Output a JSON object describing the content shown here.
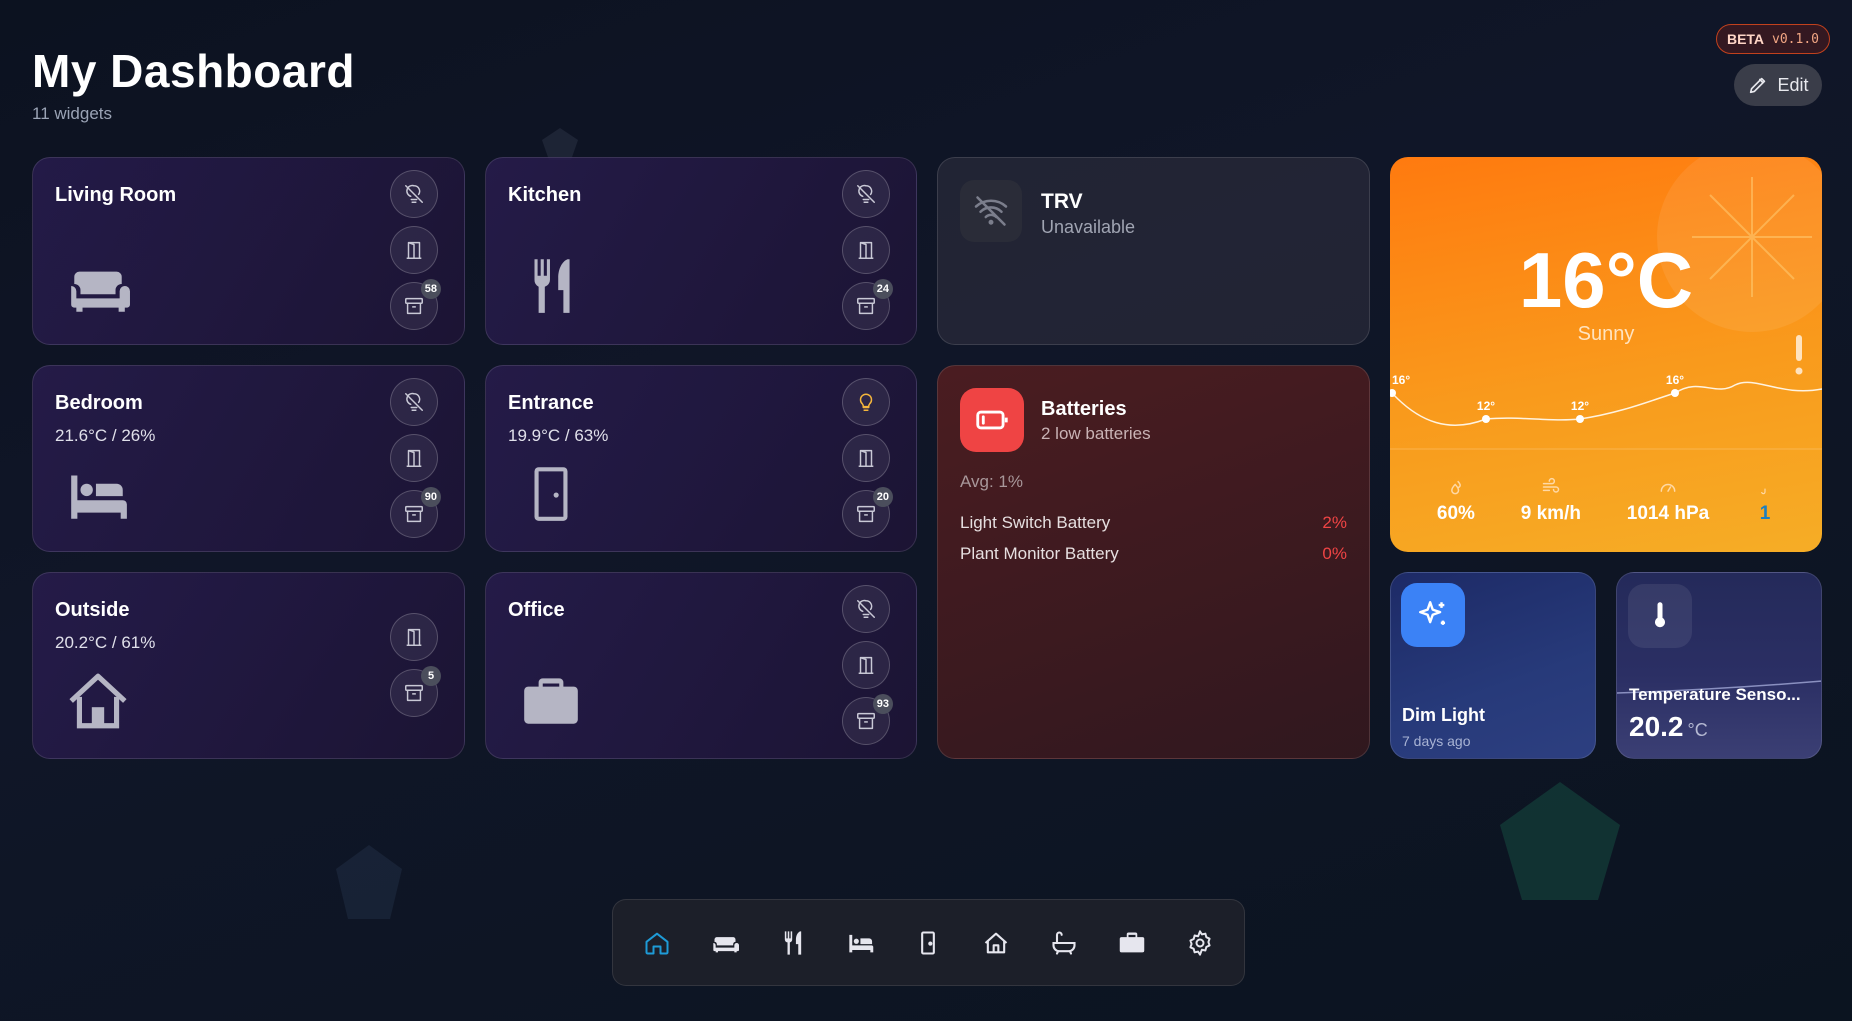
{
  "header": {
    "title": "My Dashboard",
    "widget_count": "11 widgets"
  },
  "beta": {
    "label": "BETA",
    "version": "v0.1.0"
  },
  "edit_label": "Edit",
  "rooms": {
    "living": {
      "title": "Living Room",
      "stat": "",
      "badge": "58"
    },
    "kitchen": {
      "title": "Kitchen",
      "stat": "",
      "badge": "24"
    },
    "bedroom": {
      "title": "Bedroom",
      "stat": "21.6°C / 26%",
      "badge": "90"
    },
    "entrance": {
      "title": "Entrance",
      "stat": "19.9°C / 63%",
      "badge": "20"
    },
    "outside": {
      "title": "Outside",
      "stat": "20.2°C / 61%",
      "badge": "5"
    },
    "office": {
      "title": "Office",
      "stat": "",
      "badge": "93"
    }
  },
  "trv": {
    "title": "TRV",
    "status": "Unavailable"
  },
  "batteries": {
    "title": "Batteries",
    "subtitle": "2 low batteries",
    "avg": "Avg: 1%",
    "items": [
      {
        "name": "Light Switch Battery",
        "value": "2%"
      },
      {
        "name": "Plant Monitor Battery",
        "value": "0%"
      }
    ]
  },
  "weather": {
    "temp": "16°C",
    "condition": "Sunny",
    "forecast": [
      {
        "label": "16°",
        "temp": 16
      },
      {
        "label": "12°",
        "temp": 12
      },
      {
        "label": "12°",
        "temp": 12
      },
      {
        "label": "16°",
        "temp": 16
      }
    ],
    "humidity": "60%",
    "wind": "9 km/h",
    "pressure": "1014 hPa",
    "extra": "1",
    "colors": {
      "accent": "#ff7a0f",
      "extra_value": "#1e7fc0"
    }
  },
  "dim_light": {
    "title": "Dim Light",
    "time": "7 days ago"
  },
  "temp_sensor": {
    "title": "Temperature Senso...",
    "value": "20.2",
    "unit": "°C"
  },
  "nav": [
    "home-icon",
    "sofa-icon",
    "utensils-icon",
    "bed-icon",
    "door-icon",
    "house-icon",
    "bath-icon",
    "briefcase-icon",
    "settings-icon"
  ]
}
